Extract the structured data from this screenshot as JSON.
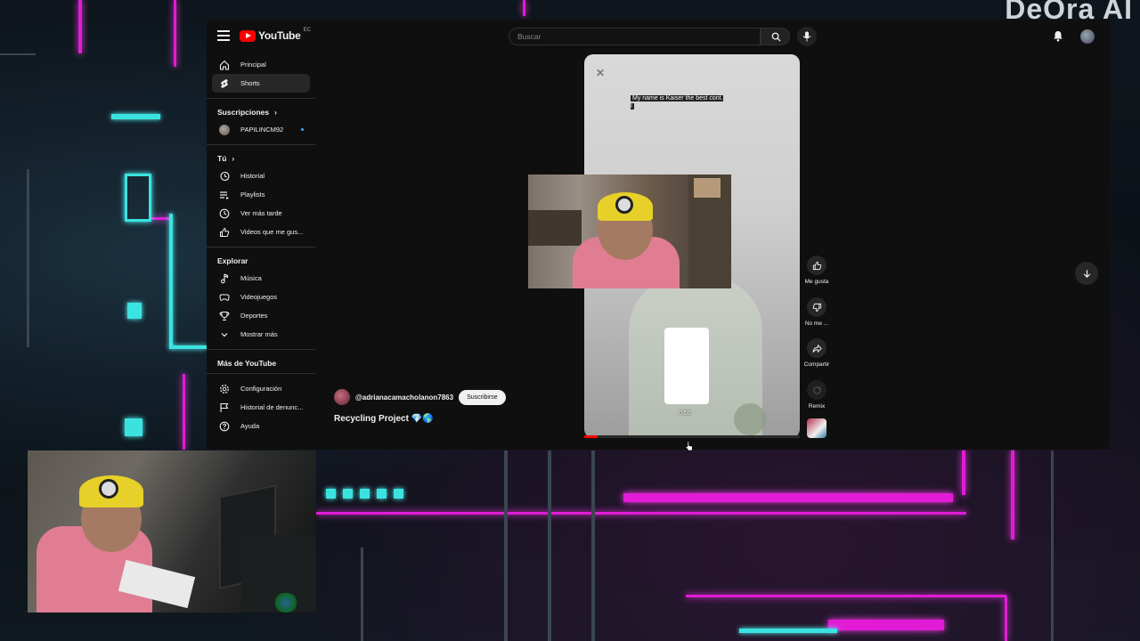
{
  "brand_overlay": "DeOra AI",
  "youtube": {
    "logo_text": "YouTube",
    "logo_region": "EC",
    "search": {
      "placeholder": "Buscar"
    },
    "sidebar": {
      "main": [
        {
          "label": "Principal",
          "icon": "home-icon"
        },
        {
          "label": "Shorts",
          "icon": "shorts-icon",
          "active": true
        }
      ],
      "subscriptions_header": "Suscripciones",
      "subscriptions": [
        {
          "label": "PAPILINCM92"
        }
      ],
      "you_header": "Tú",
      "you": [
        {
          "label": "Historial",
          "icon": "history-icon"
        },
        {
          "label": "Playlists",
          "icon": "playlist-icon"
        },
        {
          "label": "Ver más tarde",
          "icon": "watch-later-icon"
        },
        {
          "label": "Videos que me gus...",
          "icon": "thumbs-up-icon"
        }
      ],
      "explore_header": "Explorar",
      "explore": [
        {
          "label": "Música",
          "icon": "music-icon"
        },
        {
          "label": "Videojuegos",
          "icon": "gaming-icon"
        },
        {
          "label": "Deportes",
          "icon": "trophy-icon"
        },
        {
          "label": "Mostrar más",
          "icon": "chevron-down-icon"
        }
      ],
      "more_header": "Más de YouTube",
      "more": [
        {
          "label": "Configuración",
          "icon": "gear-icon"
        },
        {
          "label": "Historial de denunc...",
          "icon": "flag-icon"
        },
        {
          "label": "Ayuda",
          "icon": "help-icon"
        }
      ]
    },
    "short": {
      "caption": "My name is Kaiser the best cont. I",
      "time": "0:55",
      "progress": 0.06,
      "channel": "@adrianacamacholanon7863",
      "subscribe": "Suscribirse",
      "title": "Recycling Project 💎🌎"
    },
    "actions": {
      "like": "Me gusta",
      "dislike": "No me ...",
      "share": "Compartir",
      "remix": "Remix"
    }
  }
}
